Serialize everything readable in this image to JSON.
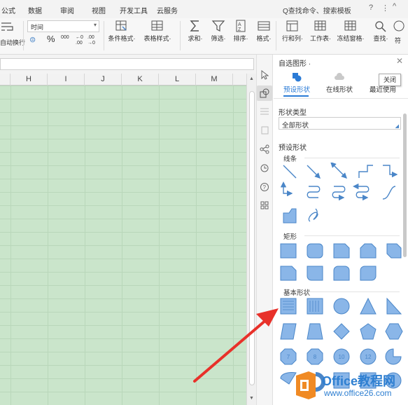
{
  "menubar": {
    "items": [
      "公式",
      "数据",
      "审阅",
      "视图",
      "开发工具",
      "云服务"
    ],
    "search": "Q查找命令、搜索模板",
    "right_icons": [
      "?",
      "⋮",
      "^"
    ]
  },
  "ribbon": {
    "wrap_label": "自动换行",
    "format_value": "时间",
    "percent": "%",
    "thousands": "000",
    "inc_decimal": "←0 .00",
    "dec_decimal": ".00 →0",
    "buttons": [
      "条件格式·",
      "表格样式·",
      "求和·",
      "筛选·",
      "排序·",
      "格式·",
      "行和列·",
      "工作表·",
      "冻结窗格·",
      "查找·",
      "符"
    ]
  },
  "columns": [
    "H",
    "I",
    "J",
    "K",
    "L",
    "M"
  ],
  "panel": {
    "title": "自选图形 ·",
    "close_tooltip": "关闭",
    "tabs": [
      "预设形状",
      "在线形状",
      "最近使用"
    ],
    "type_label": "形状类型",
    "type_value": "全部形状",
    "preset_label": "预设形状",
    "sections": {
      "lines": "线条",
      "rect": "矩形",
      "basic": "基本形状"
    },
    "badges": [
      "7",
      "8",
      "10",
      "12"
    ]
  },
  "watermark": {
    "title": "Office教程网",
    "url": "www.office26.com"
  },
  "colors": {
    "shape_fill": "#8ab6e8",
    "shape_stroke": "#4a86c8",
    "grid_bg": "#cae5cb",
    "accent": "#2b7bd6",
    "arrow": "#e8312a",
    "logo": "#f08a24"
  }
}
